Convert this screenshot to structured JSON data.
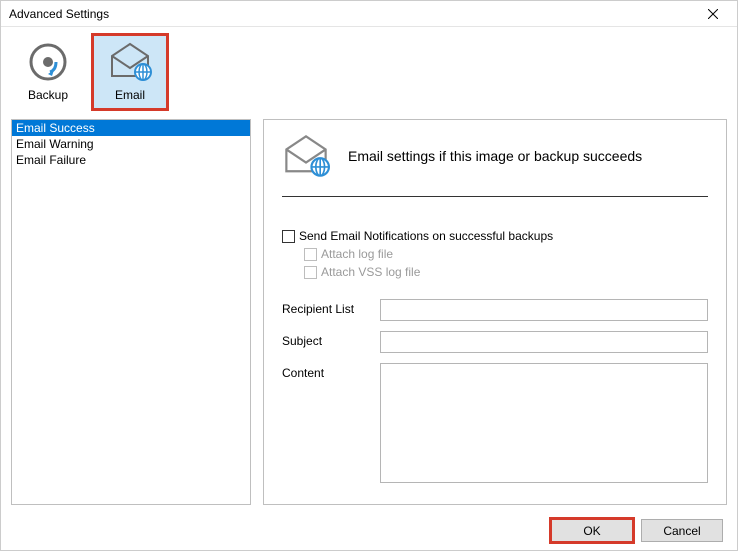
{
  "window": {
    "title": "Advanced Settings"
  },
  "toolbar": {
    "backup_label": "Backup",
    "email_label": "Email"
  },
  "sidebar": {
    "items": [
      {
        "label": "Email Success",
        "selected": true
      },
      {
        "label": "Email Warning",
        "selected": false
      },
      {
        "label": "Email Failure",
        "selected": false
      }
    ]
  },
  "panel": {
    "title": "Email settings if this image or backup succeeds",
    "send_notifications": "Send Email Notifications on successful backups",
    "attach_log": "Attach log file",
    "attach_vss_log": "Attach VSS log file",
    "recipient_label": "Recipient List",
    "recipient_value": "",
    "subject_label": "Subject",
    "subject_value": "",
    "content_label": "Content",
    "content_value": ""
  },
  "footer": {
    "ok": "OK",
    "cancel": "Cancel"
  }
}
